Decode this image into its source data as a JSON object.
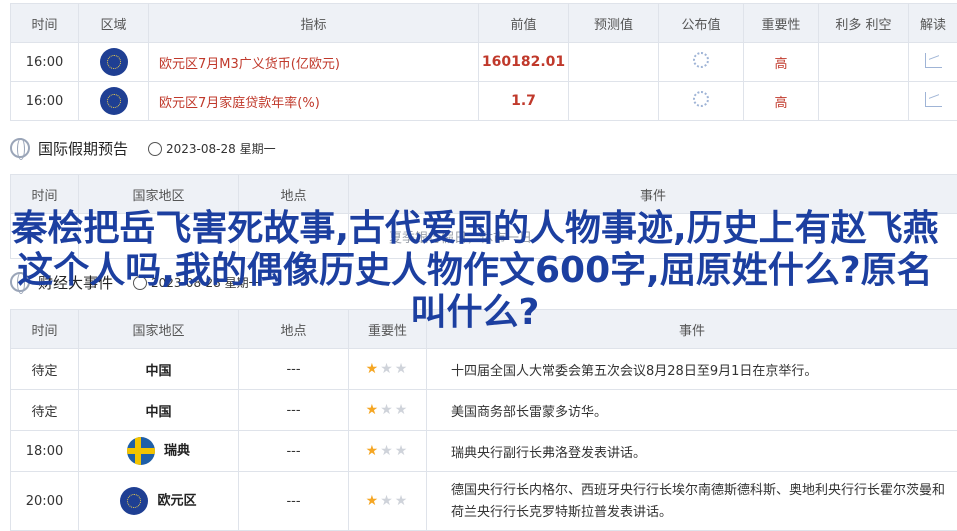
{
  "indicators": {
    "headers": [
      "时间",
      "区域",
      "指标",
      "前值",
      "预测值",
      "公布值",
      "重要性",
      "利多 利空",
      "解读"
    ],
    "rows": [
      {
        "time": "16:00",
        "name": "欧元区7月M3广义货币(亿欧元)",
        "prev": "160182.01",
        "importance": "高"
      },
      {
        "time": "16:00",
        "name": "欧元区7月家庭贷款年率(%)",
        "prev": "1.7",
        "importance": "高"
      }
    ]
  },
  "holiday": {
    "title": "国际假期预告",
    "date": "2023-08-28 星期一",
    "headers": [
      "时间",
      "国家地区",
      "地点",
      "事件"
    ],
    "partial_text": "夏季银行假日，休市一日"
  },
  "finance": {
    "title": "财经大事件",
    "date": "2023-08-28 星期一",
    "headers": [
      "时间",
      "国家地区",
      "地点",
      "重要性",
      "事件"
    ],
    "rows": [
      {
        "time": "待定",
        "region": "中国",
        "place": "---",
        "event": "十四届全国人大常委会第五次会议8月28日至9月1日在京举行。"
      },
      {
        "time": "待定",
        "region": "中国",
        "place": "---",
        "event": "美国商务部长雷蒙多访华。"
      },
      {
        "time": "18:00",
        "region": "瑞典",
        "place": "---",
        "event": "瑞典央行副行长弗洛登发表讲话。"
      },
      {
        "time": "20:00",
        "region": "欧元区",
        "place": "---",
        "event": "德国央行行长内格尔、西班牙央行行长埃尔南德斯德科斯、奥地利央行行长霍尔茨曼和荷兰央行行长克罗特斯拉普发表讲话。"
      }
    ]
  },
  "overlay_title": "秦桧把岳飞害死故事,古代爱国的人物事迹,历史上有赵飞燕这个人吗,我的偶像历史人物作文600字,屈原姓什么?原名叫什么?"
}
